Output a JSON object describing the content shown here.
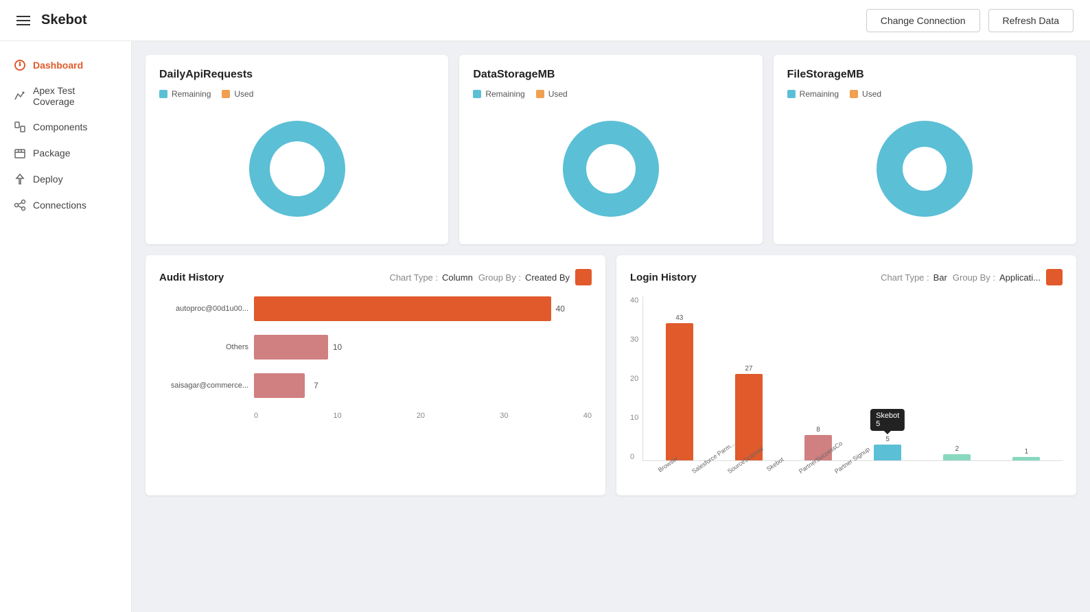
{
  "header": {
    "logo": "Skebot",
    "buttons": {
      "change_connection": "Change Connection",
      "refresh_data": "Refresh Data"
    }
  },
  "sidebar": {
    "items": [
      {
        "id": "dashboard",
        "label": "Dashboard",
        "active": true
      },
      {
        "id": "apex-test-coverage",
        "label": "Apex Test Coverage",
        "active": false
      },
      {
        "id": "components",
        "label": "Components",
        "active": false
      },
      {
        "id": "package",
        "label": "Package",
        "active": false
      },
      {
        "id": "deploy",
        "label": "Deploy",
        "active": false
      },
      {
        "id": "connections",
        "label": "Connections",
        "active": false
      }
    ]
  },
  "top_cards": [
    {
      "id": "daily-api",
      "title": "DailyApiRequests",
      "legend": [
        {
          "label": "Remaining",
          "color": "#5bbfd6"
        },
        {
          "label": "Used",
          "color": "#f0a050"
        }
      ],
      "remaining_pct": 95,
      "used_pct": 5
    },
    {
      "id": "data-storage",
      "title": "DataStorageMB",
      "legend": [
        {
          "label": "Remaining",
          "color": "#5bbfd6"
        },
        {
          "label": "Used",
          "color": "#f0a050"
        }
      ],
      "remaining_pct": 92,
      "used_pct": 8
    },
    {
      "id": "file-storage",
      "title": "FileStorageMB",
      "legend": [
        {
          "label": "Remaining",
          "color": "#5bbfd6"
        },
        {
          "label": "Used",
          "color": "#f0a050"
        }
      ],
      "remaining_pct": 90,
      "used_pct": 10
    }
  ],
  "audit_history": {
    "title": "Audit History",
    "chart_type_label": "Chart Type :",
    "chart_type_value": "Column",
    "group_by_label": "Group By :",
    "group_by_value": "Created By",
    "color": "#e05a2b",
    "bars": [
      {
        "label": "autoproc@00d1u00...",
        "value": 40,
        "max": 45,
        "color": "#e05a2b"
      },
      {
        "label": "Others",
        "value": 10,
        "max": 45,
        "color": "#d08080"
      },
      {
        "label": "saisagar@commerce...",
        "value": 7,
        "max": 45,
        "color": "#d08080"
      }
    ],
    "x_axis": [
      "0",
      "10",
      "20",
      "30",
      "40"
    ]
  },
  "login_history": {
    "title": "Login History",
    "chart_type_label": "Chart Type :",
    "chart_type_value": "Bar",
    "group_by_label": "Group By :",
    "group_by_value": "Applicati...",
    "color": "#e05a2b",
    "tooltip": {
      "label": "Skebot",
      "value": "5"
    },
    "bars": [
      {
        "label": "Browser",
        "value": 43,
        "color": "#e05a2b"
      },
      {
        "label": "Salesforce Parm...",
        "value": 27,
        "color": "#e05a2b"
      },
      {
        "label": "SourceScanner",
        "value": 8,
        "color": "#d08080"
      },
      {
        "label": "Skebot",
        "value": 5,
        "color": "#5bbfd6",
        "has_tooltip": true
      },
      {
        "label": "PartnerSuccessCo",
        "value": 2,
        "color": "#88d8c0"
      },
      {
        "label": "Partner Signup",
        "value": 1,
        "color": "#88d8c0"
      }
    ],
    "y_axis": [
      "0",
      "10",
      "20",
      "30",
      "40"
    ],
    "max": 43
  }
}
